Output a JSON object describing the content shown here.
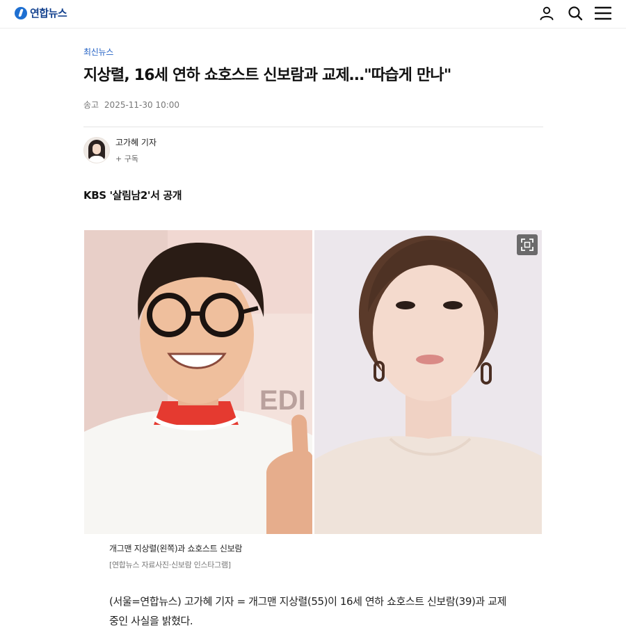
{
  "header": {
    "logo_text": "연합뉴스",
    "icons": [
      "user-icon",
      "search-icon",
      "menu-icon"
    ]
  },
  "article": {
    "category": "최신뉴스",
    "title": "지상렬, 16세 연하 쇼호스트 신보람과 교제…\"따습게 만나\"",
    "date_label": "송고",
    "date_value": "2025-11-30 10:00",
    "reporter": {
      "name": "고가혜 기자",
      "subscribe": "+ 구독"
    },
    "subheading": "KBS '살림남2'서 공개",
    "photo": {
      "caption": "개그맨 지상렬(왼쪽)과 쇼호스트 신보람",
      "credit": "[연합뉴스 자료사진·신보람 인스타그램]"
    },
    "body": [
      "(서울=연합뉴스) 고가혜 기자 = 개그맨 지상렬(55)이 16세 연하 쇼호스트 신보람(39)과 교제",
      "중인 사실을 밝혔다."
    ]
  },
  "colors": {
    "brand": "#14428f",
    "category": "#2160c4"
  }
}
